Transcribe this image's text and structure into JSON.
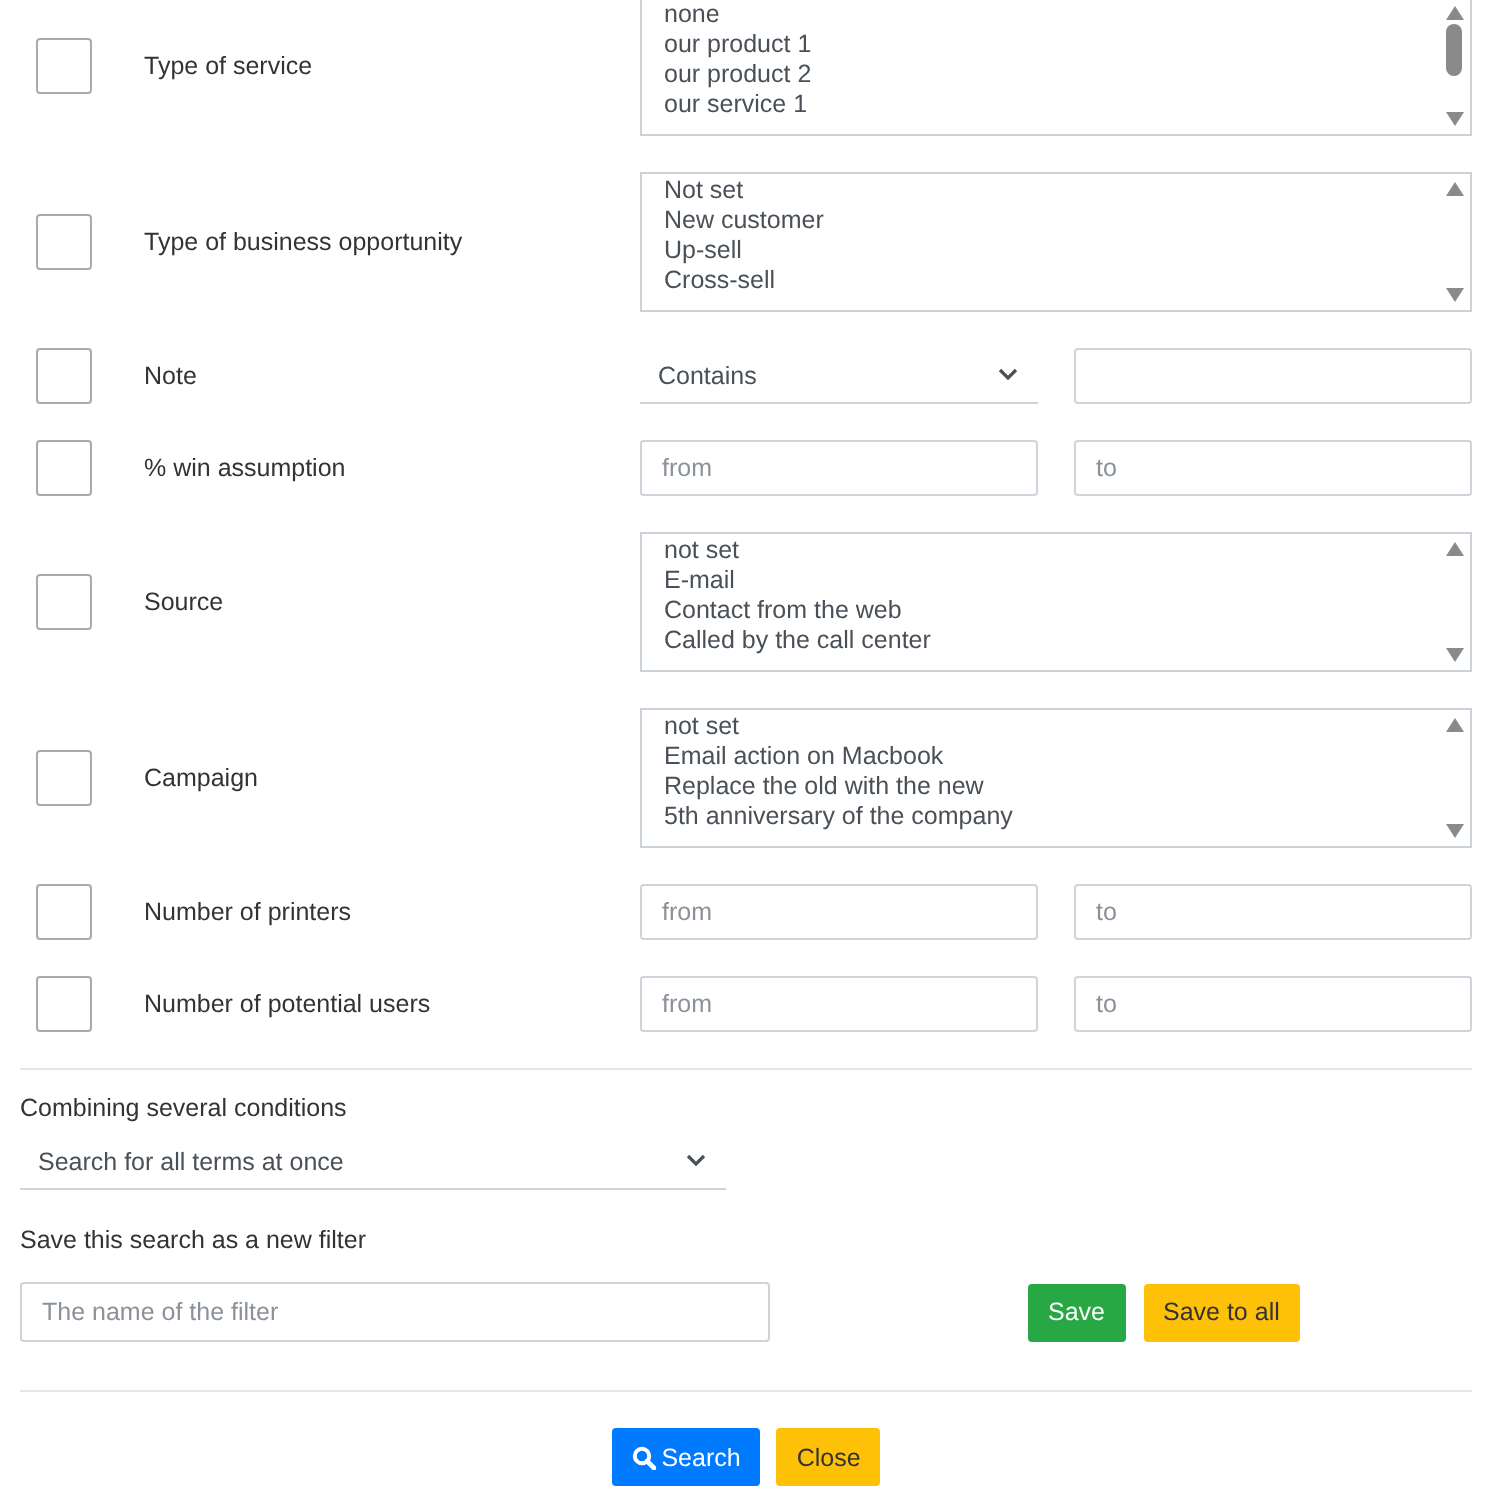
{
  "filters": [
    {
      "kind": "list",
      "label": "Type of service",
      "checked": false,
      "overflowing": true,
      "options": [
        "none",
        "our product 1",
        "our product 2",
        "our service 1"
      ]
    },
    {
      "kind": "list",
      "label": "Type of business opportunity",
      "checked": false,
      "overflowing": false,
      "options": [
        "Not set",
        "New customer",
        "Up-sell",
        "Cross-sell"
      ]
    },
    {
      "kind": "text",
      "label": "Note",
      "checked": false,
      "operator": "Contains"
    },
    {
      "kind": "range",
      "label": "% win assumption",
      "checked": false,
      "from_placeholder": "from",
      "to_placeholder": "to"
    },
    {
      "kind": "list",
      "label": "Source",
      "checked": false,
      "overflowing": false,
      "options": [
        "not set",
        "E-mail",
        "Contact from the web",
        "Called by the call center"
      ]
    },
    {
      "kind": "list",
      "label": "Campaign",
      "checked": false,
      "overflowing": false,
      "options": [
        "not set",
        "Email action on Macbook",
        "Replace the old with the new",
        "5th anniversary of the company"
      ]
    },
    {
      "kind": "range",
      "label": "Number of printers",
      "checked": false,
      "from_placeholder": "from",
      "to_placeholder": "to"
    },
    {
      "kind": "range",
      "label": "Number of potential users",
      "checked": false,
      "from_placeholder": "from",
      "to_placeholder": "to"
    }
  ],
  "combine": {
    "label": "Combining several conditions",
    "value": "Search for all terms at once"
  },
  "save_filter": {
    "label": "Save this search as a new filter",
    "placeholder": "The name of the filter",
    "buttons": [
      {
        "label": "Save",
        "kind": "success"
      },
      {
        "label": "Save to all",
        "kind": "warning"
      }
    ]
  },
  "actions": [
    {
      "label": "Search",
      "kind": "primary"
    },
    {
      "label": "Close",
      "kind": "warning"
    }
  ]
}
